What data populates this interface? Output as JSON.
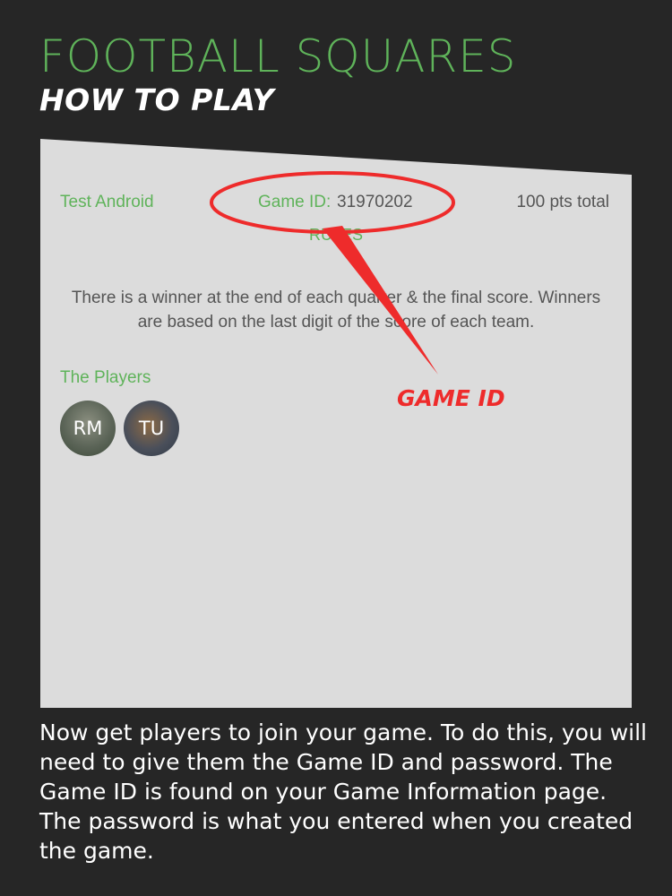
{
  "header": {
    "title": "FOOTBALL SQUARES",
    "subtitle": "HOW TO PLAY"
  },
  "game": {
    "name": "Test Android",
    "id_label": "Game ID:",
    "id_value": "31970202",
    "points": "100 pts total",
    "rules_heading": "RULES",
    "rules_text": "There is a winner at the end of each quarter & the final score. Winners are based on the last digit of the score of each team.",
    "players_heading": "The Players",
    "players": [
      {
        "initials": "RM"
      },
      {
        "initials": "TU"
      }
    ]
  },
  "annotation": {
    "label": "GAME ID",
    "color": "#ee2b2b"
  },
  "description": "Now get players to join your game. To do this, you will need to give them the Game ID and password. The Game ID is found on your Game Information page. The password is what you entered when you created the game.",
  "colors": {
    "background": "#262626",
    "accent": "#5fb35a",
    "panel": "#dcdcdc"
  }
}
